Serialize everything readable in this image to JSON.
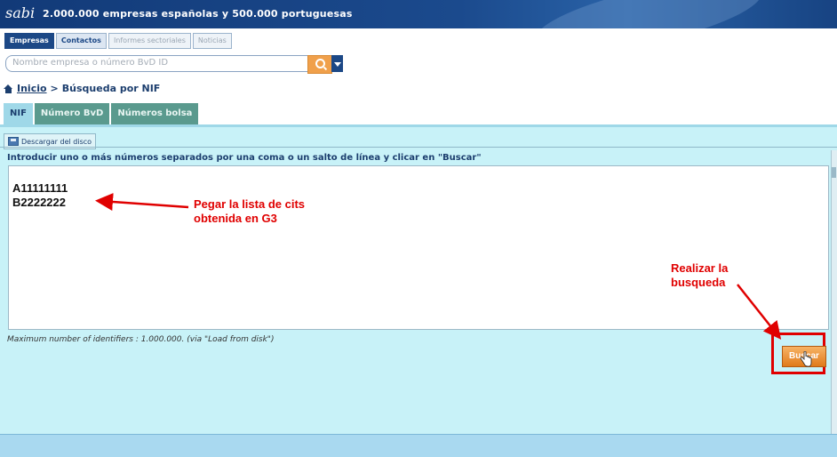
{
  "header": {
    "logo": "sabi",
    "tagline": "2.000.000 empresas españolas y 500.000 portuguesas"
  },
  "top_tabs": [
    {
      "label": "Empresas",
      "state": "active"
    },
    {
      "label": "Contactos",
      "state": "on"
    },
    {
      "label": "Informes sectoriales",
      "state": "disabled"
    },
    {
      "label": "Noticias",
      "state": "disabled"
    }
  ],
  "search": {
    "placeholder": "Nombre empresa o número BvD ID"
  },
  "breadcrumb": {
    "home": "Inicio",
    "separator": ">",
    "current": "Búsqueda por NIF"
  },
  "tabs": [
    {
      "label": "NIF",
      "active": true
    },
    {
      "label": "Número BvD",
      "active": false
    },
    {
      "label": "Números bolsa",
      "active": false
    }
  ],
  "download_button": "Descargar del disco",
  "instruction": "Introducir uno o más números separados por una coma o un salto de línea y clicar en \"Buscar\"",
  "textarea_lines": [
    "A11111111",
    "B2222222"
  ],
  "max_note": "Maximum number of identifiers : 1.000.000. (via \"Load from disk\")",
  "buscar_button": "Buscar",
  "annotations": {
    "paste_line1": "Pegar la lista de cits",
    "paste_line2": "obtenida en G3",
    "search_line1": "Realizar la",
    "search_line2": "busqueda"
  },
  "colors": {
    "header": "#1b4a8d",
    "panel": "#c8f2f8",
    "accent_orange": "#e07a1a",
    "annotation_red": "#e00000"
  }
}
